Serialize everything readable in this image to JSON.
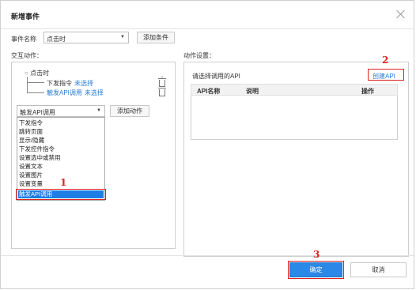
{
  "dialog": {
    "title": "新增事件"
  },
  "event_name": {
    "label": "事件名称",
    "value": "点击时",
    "add_condition": "添加条件"
  },
  "interaction": {
    "label": "交互动作：",
    "tree": {
      "root": "点击时",
      "items": [
        {
          "label": "下发指令",
          "status": "未选择"
        },
        {
          "label": "触发API调用",
          "status": "未选择"
        }
      ]
    },
    "action_select": {
      "value": "触发API调用"
    },
    "add_action": "添加动作",
    "dropdown_options": [
      "下发指令",
      "跳转页面",
      "显示/隐藏",
      "下发控件指令",
      "设置选中或禁用",
      "设置文本",
      "设置图片",
      "设置变量",
      "触发API调用"
    ]
  },
  "settings": {
    "label": "动作设置：",
    "hint": "请选择调用的API",
    "create_api": "创建API",
    "columns": [
      "API名称",
      "说明",
      "操作"
    ]
  },
  "footer": {
    "ok": "确定",
    "cancel": "取消"
  },
  "annotations": [
    "1",
    "2",
    "3"
  ],
  "colors": {
    "accent": "#2b88e6",
    "marker": "#e02020",
    "link": "#2a7ad6"
  }
}
